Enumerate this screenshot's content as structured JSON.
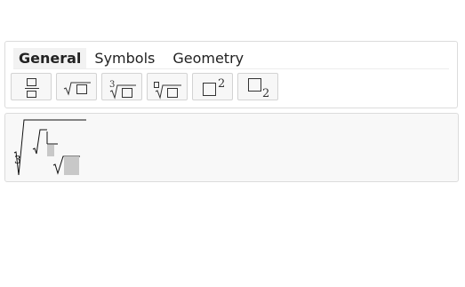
{
  "tabs": [
    {
      "label": "General",
      "active": true
    },
    {
      "label": "Symbols",
      "active": false
    },
    {
      "label": "Geometry",
      "active": false
    }
  ],
  "buttons": [
    {
      "name": "fraction-button",
      "icon": "fraction-icon"
    },
    {
      "name": "square-root-button",
      "icon": "square-root-icon"
    },
    {
      "name": "cube-root-button",
      "icon": "cube-root-icon",
      "index": "3"
    },
    {
      "name": "nth-root-button",
      "icon": "nth-root-icon"
    },
    {
      "name": "superscript-button",
      "icon": "superscript-icon",
      "exponent": "2"
    },
    {
      "name": "subscript-button",
      "icon": "subscript-icon",
      "subscript": "2"
    }
  ],
  "editor": {
    "root_index": "3",
    "placeholder_color": "#c8c8c8"
  }
}
